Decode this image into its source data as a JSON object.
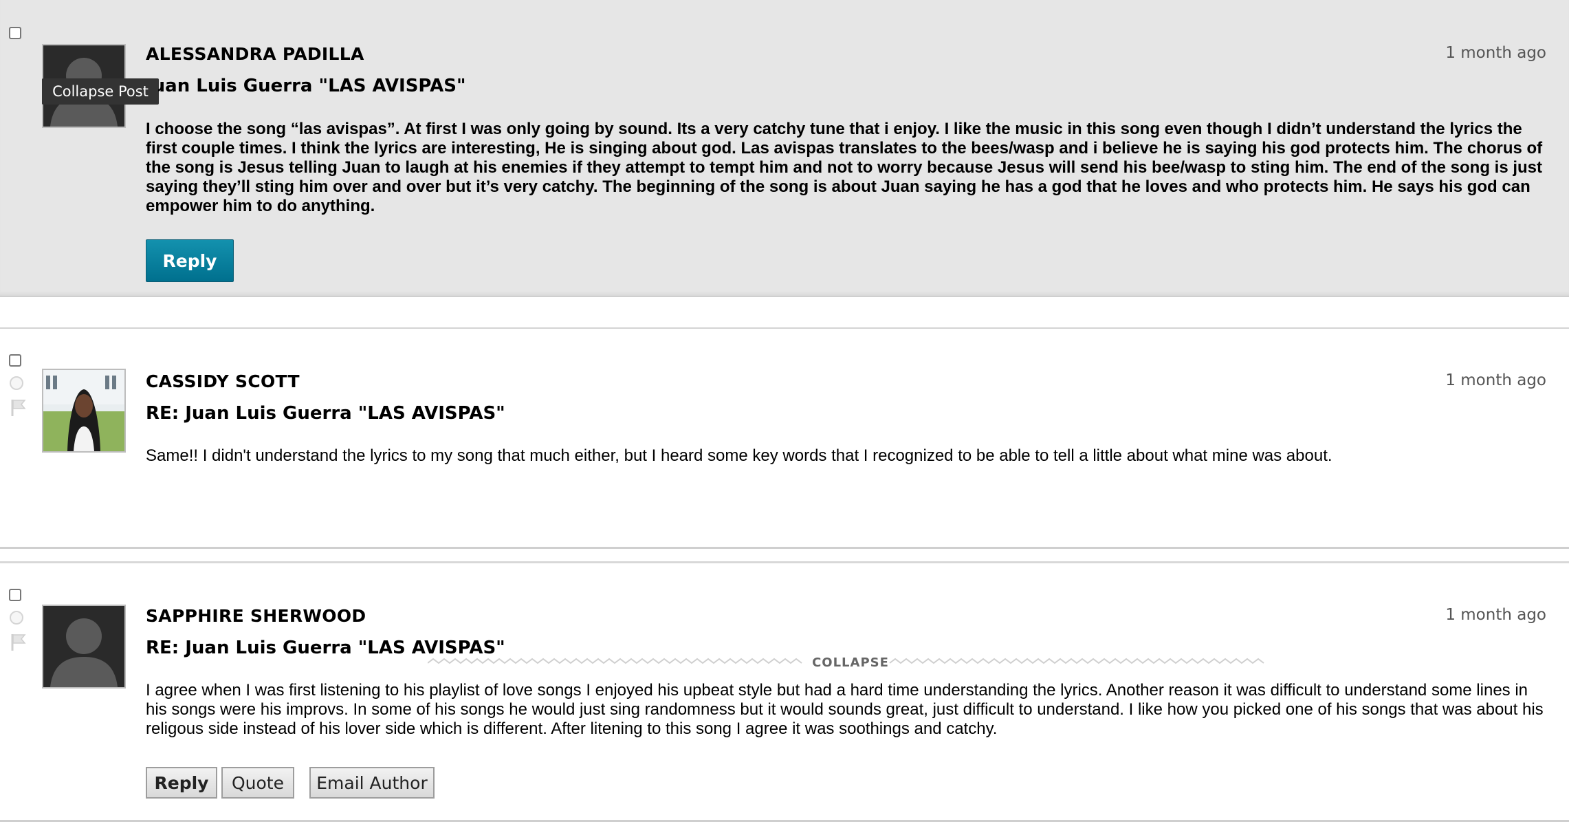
{
  "tooltip": "Collapse Post",
  "posts": [
    {
      "author": "ALESSANDRA PADILLA",
      "time": "1 month ago",
      "title": "Juan Luis Guerra \"LAS AVISPAS\"",
      "body": "I choose the song “las avispas”. At first I was only going by sound. Its a very catchy tune that i enjoy. I like the music in this song even though I didn’t understand the lyrics the first couple times. I think the lyrics are interesting, He is singing about god. Las avispas translates to the bees/wasp and i believe he is saying his god protects him. The chorus of the song is Jesus telling Juan to laugh at his enemies if they attempt to tempt him and not to worry because Jesus will send his bee/wasp to sting him. The end of the song is just saying they’ll sting him over and over but it’s very catchy.  The beginning of the song is about Juan saying he has a god that he loves and who protects him. He says his god can empower him to do anything.",
      "reply_label": "Reply"
    },
    {
      "author": "CASSIDY SCOTT",
      "time": "1 month ago",
      "title": "RE: Juan Luis Guerra \"LAS AVISPAS\"",
      "body": "Same!! I didn't understand the lyrics to my song that much either, but I heard some key words that I recognized to be able to tell a little about what mine was about."
    },
    {
      "author": "SAPPHIRE SHERWOOD",
      "time": "1 month ago",
      "title": "RE: Juan Luis Guerra \"LAS AVISPAS\"",
      "collapse_label": "COLLAPSE",
      "body": "I agree when I was first listening to his playlist of love songs I enjoyed his upbeat style but had a hard time understanding the lyrics. Another reason it was difficult to understand some lines in his songs were his improvs. In some of his songs he would just sing randomness but it would sounds great, just difficult to understand. I like how you picked one of his songs that was about his religous side instead of his lover side which is different. After litening to this song I agree it was soothings and catchy.",
      "reply_label": "Reply",
      "quote_label": "Quote",
      "email_label": "Email Author"
    }
  ]
}
